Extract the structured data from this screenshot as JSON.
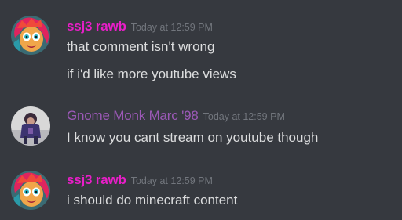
{
  "colors": {
    "background": "#36393f",
    "message_text": "#dcddde",
    "timestamp": "#72767d",
    "ssj3_rawb_name": "#e91ec8",
    "gnome_monk_name": "#9b59b6"
  },
  "messages": [
    {
      "username": "ssj3 rawb",
      "timestamp": "Today at 12:59 PM",
      "avatar_icon": "cartoon-girl-avatar",
      "lines": [
        "that comment isn't wrong",
        "if i'd like more youtube views"
      ]
    },
    {
      "username": "Gnome Monk Marc '98",
      "timestamp": "Today at 12:59 PM",
      "avatar_icon": "photo-person-avatar",
      "lines": [
        "I know you cant stream on youtube though"
      ]
    },
    {
      "username": "ssj3 rawb",
      "timestamp": "Today at 12:59 PM",
      "avatar_icon": "cartoon-girl-avatar",
      "lines": [
        "i should do minecraft content"
      ]
    }
  ]
}
